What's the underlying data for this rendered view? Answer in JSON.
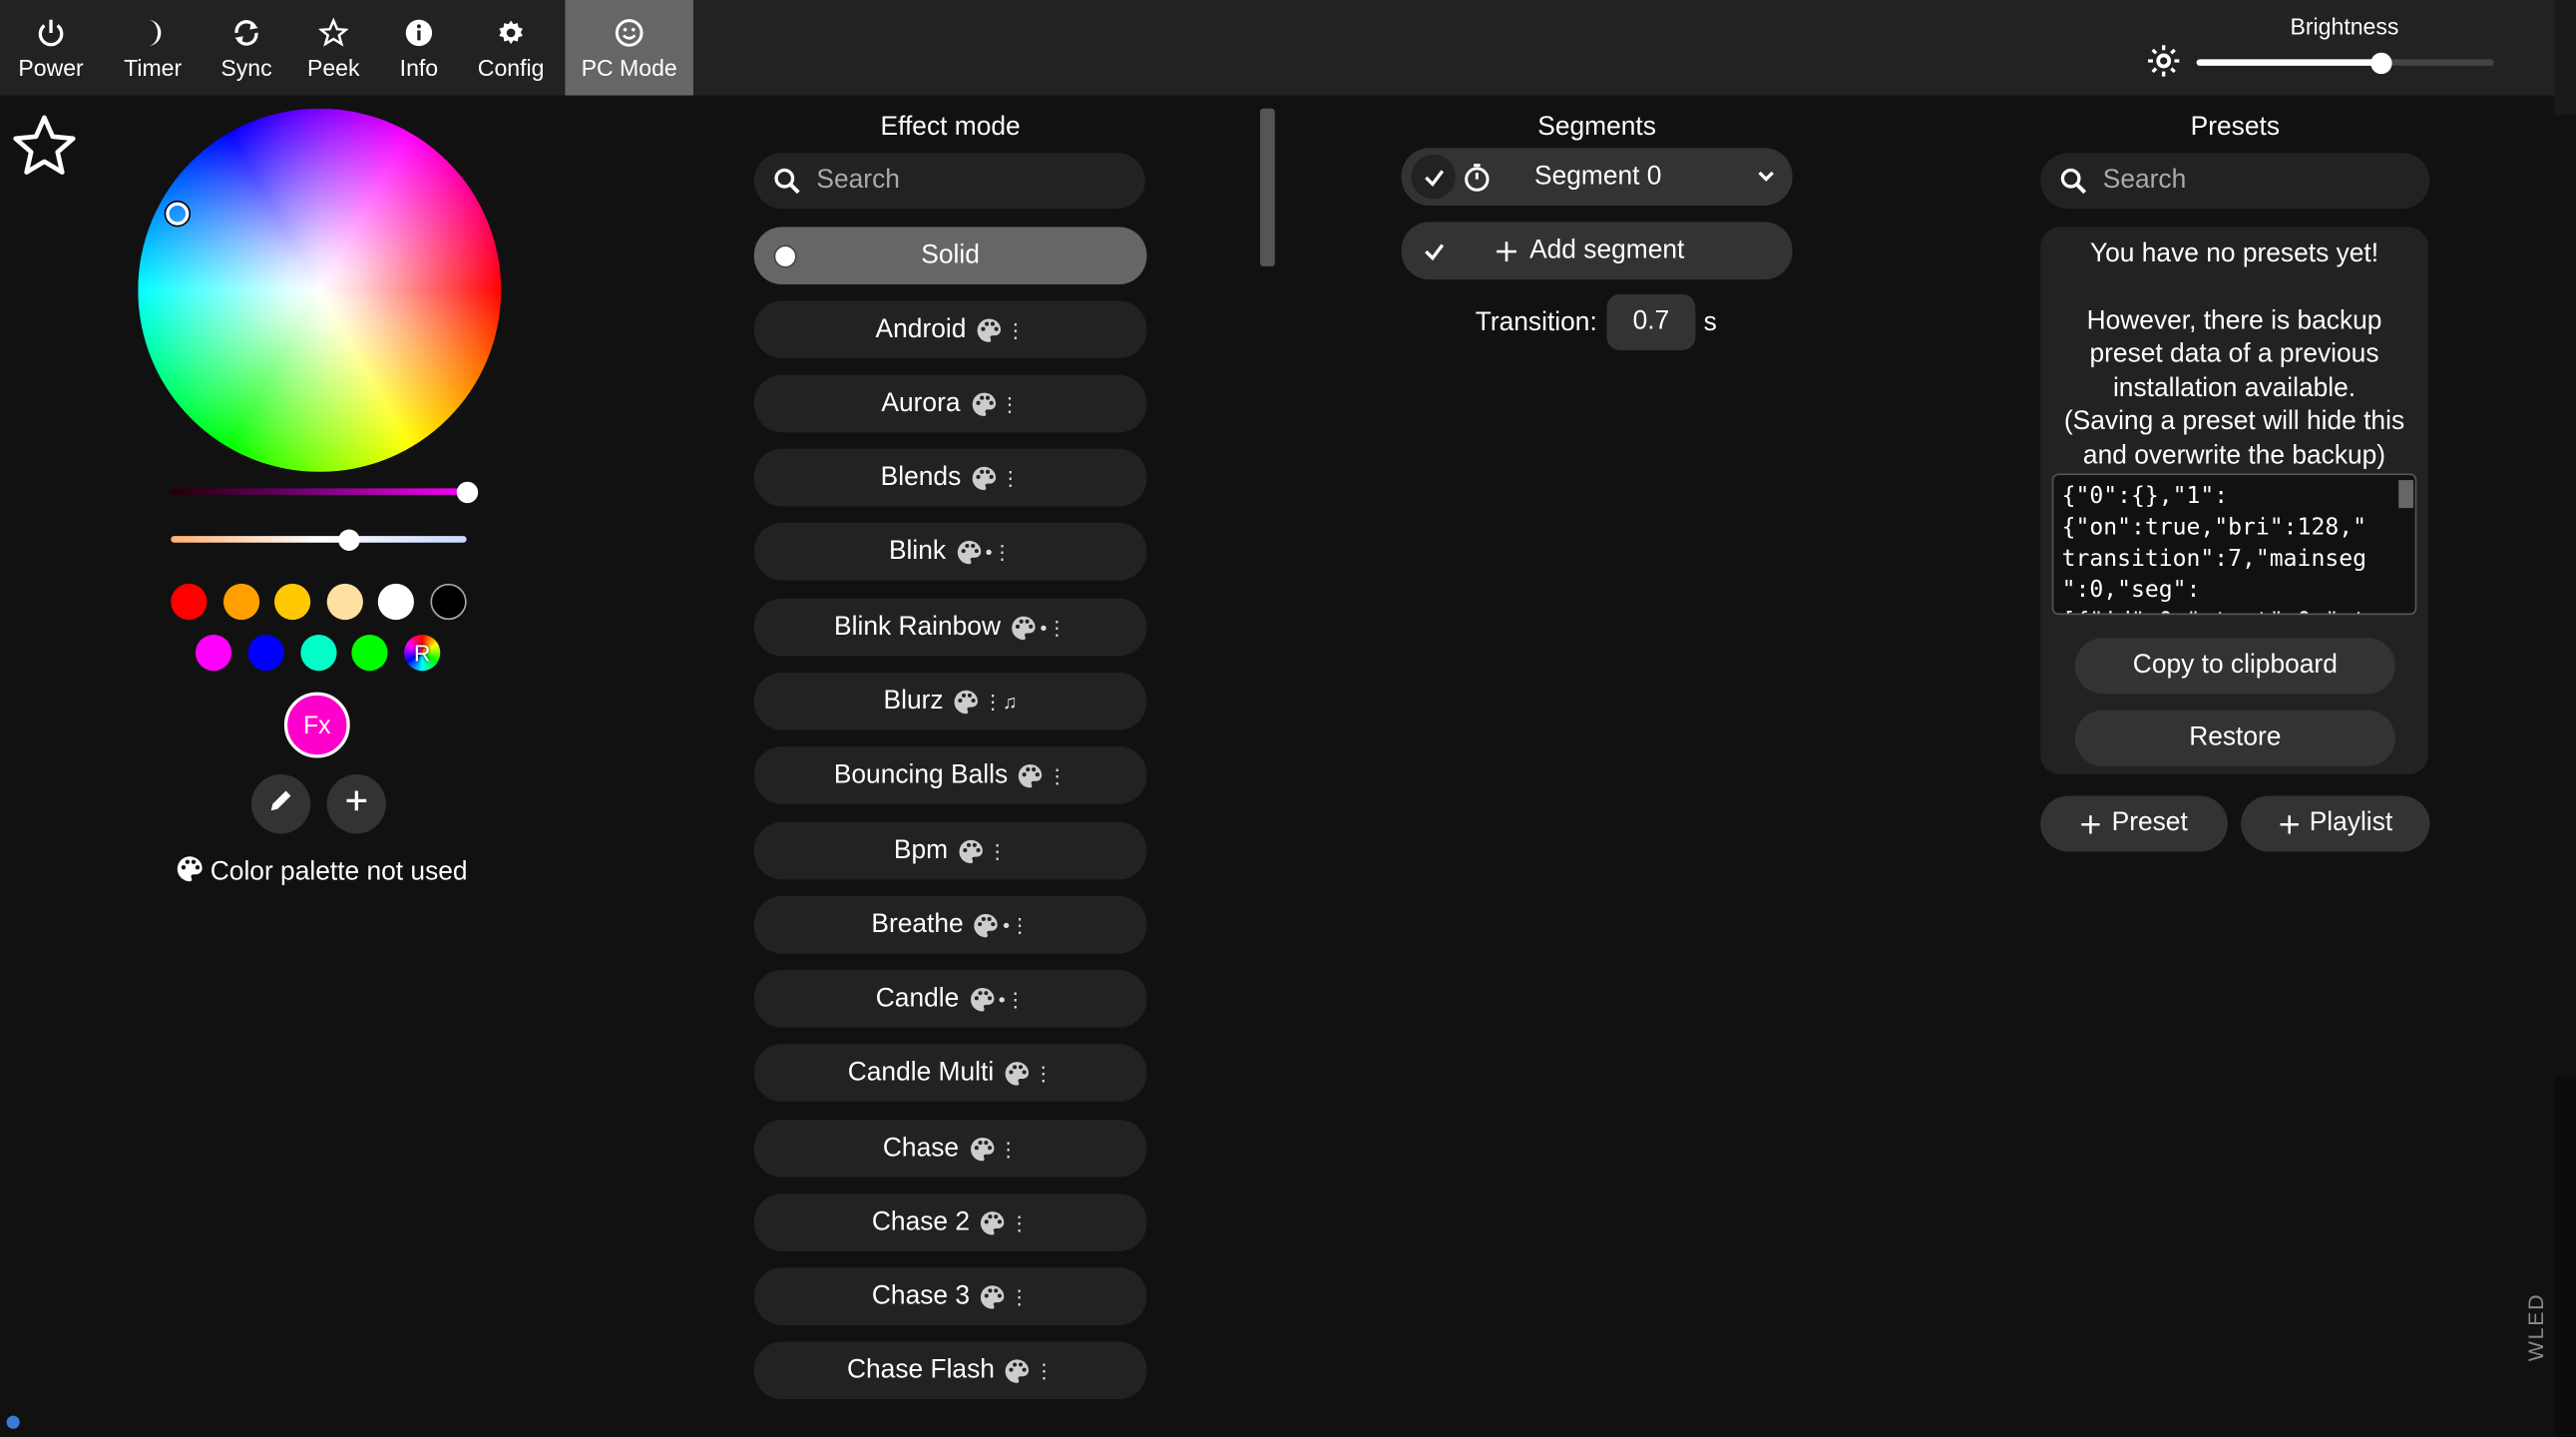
{
  "topbar": {
    "buttons": [
      {
        "label": "Power",
        "icon": "power-icon"
      },
      {
        "label": "Timer",
        "icon": "moon-icon"
      },
      {
        "label": "Sync",
        "icon": "sync-icon"
      },
      {
        "label": "Peek",
        "icon": "star-icon"
      },
      {
        "label": "Info",
        "icon": "info-icon"
      },
      {
        "label": "Config",
        "icon": "gear-icon"
      },
      {
        "label": "PC Mode",
        "icon": "smiley-icon"
      }
    ],
    "brightness_label": "Brightness",
    "brightness_value": 0.62
  },
  "color": {
    "hue_slider_value": 1.0,
    "white_slider_value": 0.6,
    "swatches_row1": [
      "#ff0000",
      "#ffa000",
      "#ffc800",
      "#ffe0a0",
      "#ffffff",
      "#000000"
    ],
    "swatches_row2": [
      "#ff00ff",
      "#0000ff",
      "#00ffc8",
      "#00ff00",
      "rainbow"
    ],
    "rainbow_label": "R",
    "fx_label": "Fx",
    "palette_note": "Color palette not used"
  },
  "effects": {
    "title": "Effect mode",
    "search_placeholder": "Search",
    "items": [
      {
        "name": "Solid",
        "flags": ""
      },
      {
        "name": "Android",
        "flags": "⋮"
      },
      {
        "name": "Aurora",
        "flags": "⋮"
      },
      {
        "name": "Blends",
        "flags": "⋮"
      },
      {
        "name": "Blink",
        "flags": "•⋮"
      },
      {
        "name": "Blink Rainbow",
        "flags": "•⋮"
      },
      {
        "name": "Blurz",
        "flags": "⋮♫"
      },
      {
        "name": "Bouncing Balls",
        "flags": "⋮"
      },
      {
        "name": "Bpm",
        "flags": "⋮"
      },
      {
        "name": "Breathe",
        "flags": "•⋮"
      },
      {
        "name": "Candle",
        "flags": "•⋮"
      },
      {
        "name": "Candle Multi",
        "flags": "⋮"
      },
      {
        "name": "Chase",
        "flags": "⋮"
      },
      {
        "name": "Chase 2",
        "flags": "⋮"
      },
      {
        "name": "Chase 3",
        "flags": "⋮"
      },
      {
        "name": "Chase Flash",
        "flags": "⋮"
      }
    ]
  },
  "segments": {
    "title": "Segments",
    "segment_label": "Segment 0",
    "add_label": "Add segment",
    "transition_label": "Transition:",
    "transition_value": "0.7",
    "transition_unit": "s"
  },
  "presets": {
    "title": "Presets",
    "search_placeholder": "Search",
    "msg_line1": "You have no presets yet!",
    "msg_line2": "However, there is backup preset data of a previous installation available.",
    "msg_line3": "(Saving a preset will hide this and overwrite the backup)",
    "backup_text": "{\"0\":{},\"1\":\n{\"on\":true,\"bri\":128,\"\ntransition\":7,\"mainseg\n\":0,\"seg\":\n[{\"id\":0,\"start\":0,\"st",
    "copy_label": "Copy to clipboard",
    "restore_label": "Restore",
    "add_preset_label": "Preset",
    "add_playlist_label": "Playlist"
  },
  "brand": "WLED"
}
